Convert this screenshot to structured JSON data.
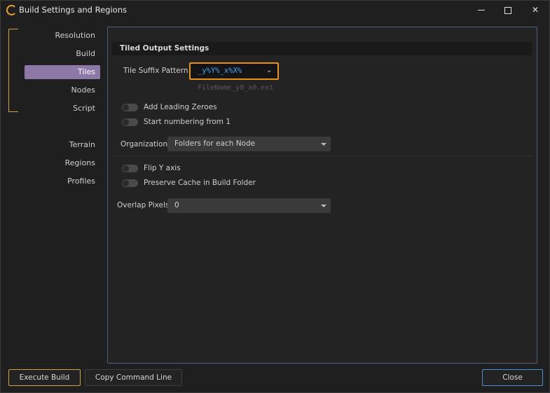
{
  "window": {
    "title": "Build Settings and Regions",
    "controls": {
      "minimize": "minimize",
      "maximize": "maximize",
      "close": "✕"
    }
  },
  "nav": {
    "group1": [
      "Resolution",
      "Build",
      "Tiles",
      "Nodes",
      "Script"
    ],
    "group2": [
      "Terrain",
      "Regions",
      "Profiles"
    ],
    "active": "Tiles"
  },
  "section": {
    "title": "Tiled Output Settings",
    "tile_suffix_label": "Tile Suffix Pattern",
    "tile_suffix_value": "_y%Y%_x%X%",
    "tile_suffix_preview": "FileName_y0_x0.ext",
    "toggles": [
      {
        "label": "Add Leading Zeroes",
        "on": false
      },
      {
        "label": "Start numbering from 1",
        "on": false
      }
    ],
    "organization_label": "Organization",
    "organization_value": "Folders for each Node",
    "toggles2": [
      {
        "label": "Flip Y axis",
        "on": false
      },
      {
        "label": "Preserve Cache in Build Folder",
        "on": false
      }
    ],
    "overlap_label": "Overlap Pixels",
    "overlap_value": "0"
  },
  "footer": {
    "execute_label": "Execute Build",
    "copy_label": "Copy Command Line",
    "close_label": "Close"
  },
  "colors": {
    "accent_gold": "#d0a23a",
    "focus_orange": "#e8921a",
    "active_nav": "#8e78a8",
    "close_border": "#4a8fd8"
  }
}
